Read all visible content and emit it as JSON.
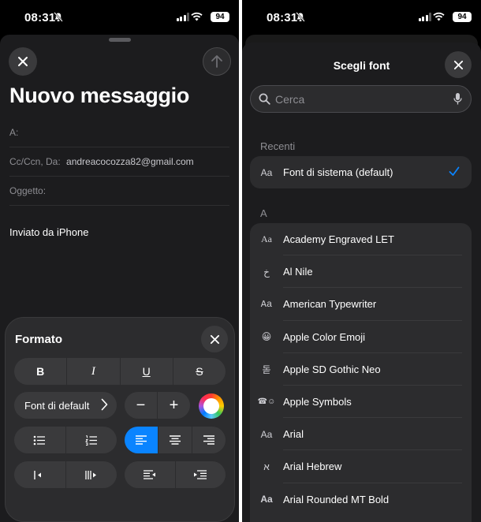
{
  "status_bar": {
    "time": "08:31",
    "battery": "94"
  },
  "compose": {
    "title": "Nuovo messaggio",
    "to_label": "A:",
    "cc_label": "Cc/Ccn, Da:",
    "cc_value": "andreacocozza82@gmail.com",
    "subject_label": "Oggetto:",
    "signature": "Inviato da iPhone"
  },
  "format": {
    "title": "Formato",
    "bold": "B",
    "italic": "I",
    "underline": "U",
    "strike": "S",
    "font_button": "Font di default",
    "decrease": "−",
    "increase": "+"
  },
  "font_picker": {
    "title": "Scegli font",
    "search_placeholder": "Cerca",
    "recents_header": "Recenti",
    "recent": {
      "preview": "Aa",
      "name": "Font di sistema (default)",
      "selected": true
    },
    "section_a_header": "A",
    "fonts": [
      {
        "preview": "Aa",
        "name": "Academy Engraved LET"
      },
      {
        "preview": "خ",
        "name": "Al Nile"
      },
      {
        "preview": "Aa",
        "name": "American Typewriter"
      },
      {
        "preview": "😀",
        "name": "Apple Color Emoji"
      },
      {
        "preview": "돋",
        "name": "Apple SD Gothic Neo"
      },
      {
        "preview": "☎☺",
        "name": "Apple Symbols"
      },
      {
        "preview": "Aa",
        "name": "Arial"
      },
      {
        "preview": "א",
        "name": "Arial Hebrew"
      },
      {
        "preview": "Aa",
        "name": "Arial Rounded MT Bold"
      }
    ]
  },
  "colors": {
    "accent": "#0a84ff",
    "sheet": "#1c1c1e",
    "control": "#3a3a3c"
  }
}
